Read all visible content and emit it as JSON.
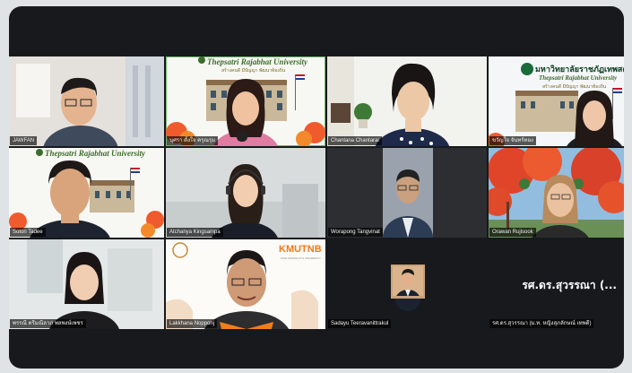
{
  "participants": [
    {
      "name": "JAWFAN",
      "bg": "#e9e6e2"
    },
    {
      "name": "นุศรา ตั้งใจ ครุณรุม",
      "bg": "#f4f6f1"
    },
    {
      "name": "Chantana Chantarai",
      "bg": "#f1f1ee"
    },
    {
      "name": "ขวัญใจ จันทร์ทอง",
      "bg": "#eef1f4"
    },
    {
      "name": "Soton Tadee",
      "bg": "#f7f7f3"
    },
    {
      "name": "Atchanya Kingsampa",
      "bg": "#dde0e1"
    },
    {
      "name": "Worapong Tangvinat",
      "bg": "#2b2d30"
    },
    {
      "name": "Orawan Rujisook",
      "bg": "#8ab4d9"
    },
    {
      "name": "พรรณี ตรีมณีลาภ พลพงษ์เพชร",
      "bg": "#dfe4e5"
    },
    {
      "name": "Lakkhana Nopponj",
      "bg": "#fbfaf6"
    },
    {
      "name": "Sadayu Teeravanittrakul",
      "bg": "#17191c"
    },
    {
      "name": "รศ.ดร.สุวรรณา (ม.ท. หญิงสุภลักษณ์ เทพดี)",
      "bg": "#17191c"
    }
  ],
  "speaker_overlay": "รศ.ดร.สุวรรณา (...",
  "banners": {
    "university_en": "Thepsatri Rajabhat University",
    "university_motto": "สร้างคนดี มีปัญญา พัฒนาท้องถิ่น",
    "university_th": "มหาวิทยาลัยราชภัฏเทพสตรี",
    "kmutnb_logo": "KMUTNB",
    "kmutnb_sub": "KING MONGKUT'S UNIVERSITY"
  },
  "colors": {
    "frame": "#17191c",
    "outer": "#dfe3e6",
    "flag_red": "#c8102e",
    "flag_blue": "#1f3f8f"
  }
}
